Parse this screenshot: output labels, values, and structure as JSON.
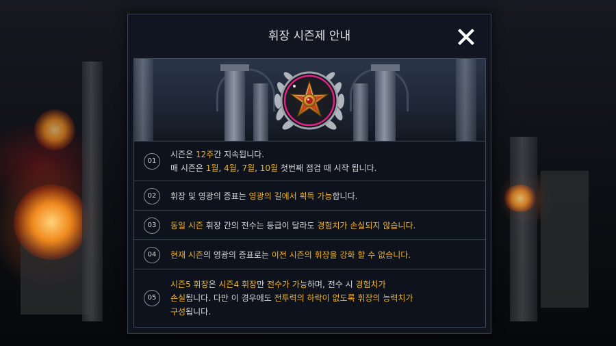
{
  "dialog": {
    "title": "휘장 시즌제 안내",
    "close_icon": "close-icon"
  },
  "banner": {
    "emblem_icon": "medal-emblem-icon"
  },
  "notices": [
    {
      "number": "01",
      "lines": [
        [
          {
            "t": "시즌은 ",
            "h": false
          },
          {
            "t": "12주",
            "h": true
          },
          {
            "t": "간 지속됩니다.",
            "h": false
          }
        ],
        [
          {
            "t": "매 시즌은 ",
            "h": false
          },
          {
            "t": "1월",
            "h": true
          },
          {
            "t": ", ",
            "h": false
          },
          {
            "t": "4월",
            "h": true
          },
          {
            "t": ", ",
            "h": false
          },
          {
            "t": "7월",
            "h": true
          },
          {
            "t": ", ",
            "h": false
          },
          {
            "t": "10월",
            "h": true
          },
          {
            "t": " 첫번째 점검 때 시작 됩니다.",
            "h": false
          }
        ]
      ]
    },
    {
      "number": "02",
      "lines": [
        [
          {
            "t": "휘장 및 영광의 증표는 ",
            "h": false
          },
          {
            "t": "영광의 길에서 획득 가능",
            "h": true
          },
          {
            "t": "합니다.",
            "h": false
          }
        ]
      ]
    },
    {
      "number": "03",
      "lines": [
        [
          {
            "t": "동일 시즌",
            "h": true
          },
          {
            "t": " 휘장 간의 전수는 등급이 달라도 ",
            "h": false
          },
          {
            "t": "경험치가 손실되지 않습니다.",
            "h": true
          }
        ]
      ]
    },
    {
      "number": "04",
      "lines": [
        [
          {
            "t": "현재 시즌",
            "h": true
          },
          {
            "t": "의 영광의 증표로는 ",
            "h": false
          },
          {
            "t": "이전 시즌의 휘장을 강화 할 수 없습니다.",
            "h": true
          }
        ]
      ]
    },
    {
      "number": "05",
      "lines": [
        [
          {
            "t": "시즌5 휘장",
            "h": true
          },
          {
            "t": "은 ",
            "h": false
          },
          {
            "t": "시즌4 휘장",
            "h": true
          },
          {
            "t": "만 ",
            "h": false
          },
          {
            "t": "전수가 가능",
            "h": true
          },
          {
            "t": "하며, 전수 시 ",
            "h": false
          },
          {
            "t": "경험치가",
            "h": true
          }
        ],
        [
          {
            "t": "손실",
            "h": true
          },
          {
            "t": "됩니다. 다만 이 경우에도 ",
            "h": false
          },
          {
            "t": "전투력의 하락이 없도록 휘장의 능력치가",
            "h": true
          }
        ],
        [
          {
            "t": "구성",
            "h": true
          },
          {
            "t": "됩니다.",
            "h": false
          }
        ]
      ]
    }
  ],
  "colors": {
    "highlight": "#f0b429",
    "body_text": "#d9d9d9",
    "dialog_bg": "#101621"
  }
}
